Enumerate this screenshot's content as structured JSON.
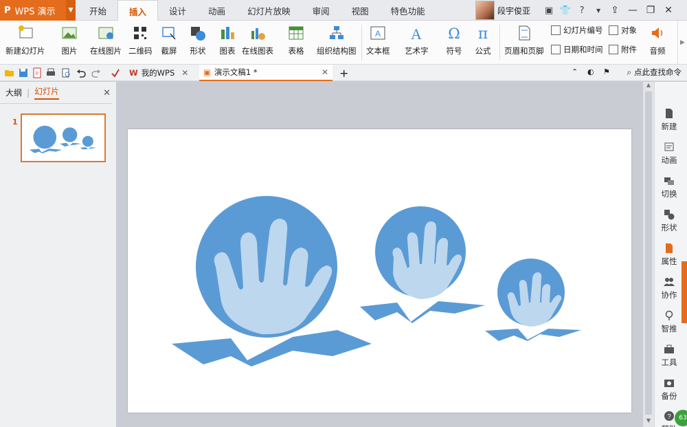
{
  "app": {
    "name": "WPS 演示",
    "accent": "#e46d1d"
  },
  "tabs": [
    {
      "label": "开始"
    },
    {
      "label": "插入"
    },
    {
      "label": "设计"
    },
    {
      "label": "动画"
    },
    {
      "label": "幻灯片放映"
    },
    {
      "label": "审阅"
    },
    {
      "label": "视图"
    },
    {
      "label": "特色功能"
    }
  ],
  "active_tab": "插入",
  "user": {
    "name": "段宇俊亚"
  },
  "ribbon": {
    "new_slide": "新建幻灯片",
    "picture": "图片",
    "online_picture": "在线图片",
    "qrcode": "二维码",
    "screenshot": "截屏",
    "shape": "形状",
    "chart": "图表",
    "online_chart": "在线图表",
    "table": "表格",
    "org_chart": "组织结构图",
    "textbox": "文本框",
    "wordart": "艺术字",
    "symbol": "符号",
    "formula": "公式",
    "header_footer": "页眉和页脚",
    "slide_number": "幻灯片编号",
    "object": "对象",
    "date_time": "日期和时间",
    "attachment": "附件",
    "audio": "音频"
  },
  "doctabs": [
    {
      "label": "我的WPS"
    },
    {
      "label": "演示文稿1 *"
    }
  ],
  "search_cmd": "点此查找命令",
  "left_panel": {
    "tab_outline": "大纲",
    "tab_slides": "幻灯片",
    "slide_number": "1"
  },
  "right_panel": [
    {
      "label": "新建",
      "icon": "new-doc-icon"
    },
    {
      "label": "动画",
      "icon": "animation-icon"
    },
    {
      "label": "切换",
      "icon": "transition-icon"
    },
    {
      "label": "形状",
      "icon": "shape-icon"
    },
    {
      "label": "属性",
      "icon": "properties-icon"
    },
    {
      "label": "协作",
      "icon": "collaborate-icon"
    },
    {
      "label": "智推",
      "icon": "smart-push-icon"
    },
    {
      "label": "工具",
      "icon": "toolbox-icon"
    },
    {
      "label": "备份",
      "icon": "backup-icon"
    },
    {
      "label": "帮助",
      "icon": "help-icon"
    }
  ],
  "network_badge": "63",
  "colors": {
    "sphere": "#5b9bd5",
    "hand": "#bdd7ee",
    "ribbon_wave": "#5b9bd5"
  }
}
